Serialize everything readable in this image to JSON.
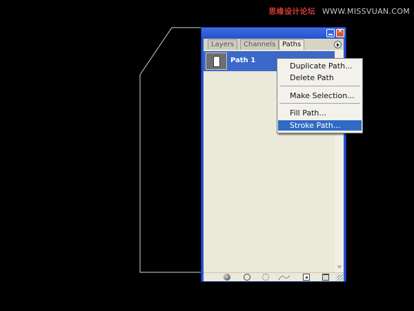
{
  "watermark": {
    "cn": "思缘设计论坛",
    "url": "WWW.MISSVUAN.COM"
  },
  "palette": {
    "tabs": [
      "Layers",
      "Channels",
      "Paths"
    ],
    "active_tab": "Paths",
    "paths": [
      {
        "name": "Path 1",
        "selected": true
      }
    ]
  },
  "context_menu": {
    "items": [
      "Duplicate Path...",
      "Delete Path",
      "Make Selection...",
      "Fill Path...",
      "Stroke Path..."
    ],
    "highlighted": "Stroke Path..."
  },
  "colors": {
    "selection": "#316ac5",
    "window_frame": "#2a55d0",
    "panel_bg": "#ebe9d9"
  }
}
